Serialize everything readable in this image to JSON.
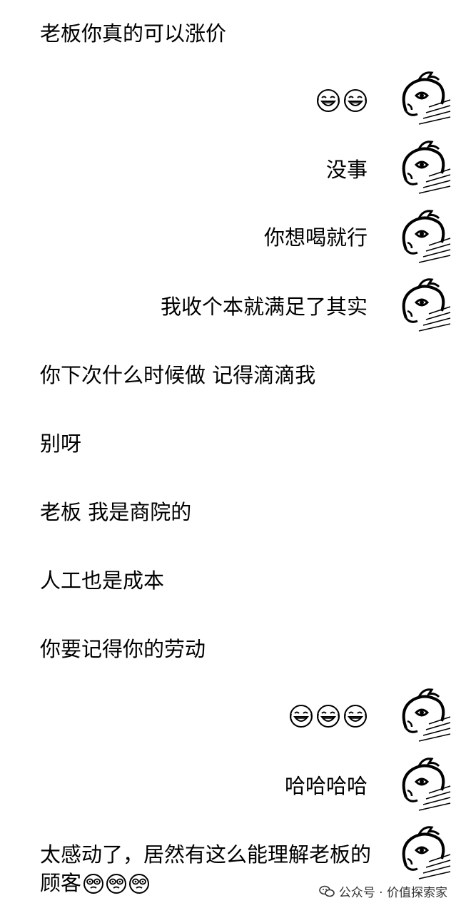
{
  "chat": {
    "messages": [
      {
        "side": "left",
        "text": "老板你真的可以涨价"
      },
      {
        "side": "right",
        "emoji": [
          "laugh-cry",
          "laugh-cry"
        ]
      },
      {
        "side": "right",
        "text": "没事"
      },
      {
        "side": "right",
        "text": "你想喝就行"
      },
      {
        "side": "right",
        "text": "我收个本就满足了其实"
      },
      {
        "side": "left",
        "text": "你下次什么时候做 记得滴滴我"
      },
      {
        "side": "left",
        "text": "别呀"
      },
      {
        "side": "left",
        "text": "老板 我是商院的"
      },
      {
        "side": "left",
        "text": "人工也是成本"
      },
      {
        "side": "left",
        "text": "你要记得你的劳动"
      },
      {
        "side": "right",
        "emoji": [
          "laugh-cry",
          "laugh-cry",
          "laugh-cry"
        ]
      },
      {
        "side": "right",
        "text": "哈哈哈哈"
      },
      {
        "side": "right",
        "text": "太感动了，居然有这么能理解老板的顾客",
        "emoji": [
          "moved-tears",
          "moved-tears",
          "moved-tears"
        ]
      }
    ]
  },
  "watermark": {
    "text": "公众号 · 价值探索家",
    "icon": "wechat-icon"
  },
  "colors": {
    "background": "#ffffff",
    "text": "#000000"
  }
}
